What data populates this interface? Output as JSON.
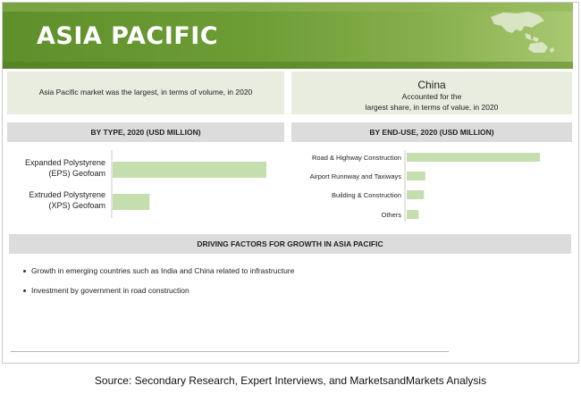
{
  "banner": {
    "title": "ASIA PACIFIC"
  },
  "summary": {
    "left_text": "Asia Pacific market was the largest, in terms of volume, in 2020",
    "right_country": "China",
    "right_line1": "Accounted for the",
    "right_line2": "largest share, in terms of value, in 2020"
  },
  "headers": {
    "by_type": "BY TYPE, 2020 (USD MILLION)",
    "by_end_use": "BY END-USE, 2020 (USD MILLION)",
    "driving": "DRIVING FACTORS FOR GROWTH IN ASIA PACIFIC"
  },
  "chart_data": [
    {
      "type": "bar",
      "orientation": "horizontal",
      "categories": [
        "Expanded Polystyrene (EPS) Geofoam",
        "Extruded Polystyrene (XPS) Geofoam"
      ],
      "category_lines": [
        [
          "Expanded Polystyrene",
          "(EPS) Geofoam"
        ],
        [
          "Extruded Polystyrene",
          "(XPS) Geofoam"
        ]
      ],
      "values": [
        100,
        24
      ],
      "xlim": [
        0,
        100
      ],
      "color": "#c5deae"
    },
    {
      "type": "bar",
      "orientation": "horizontal",
      "categories": [
        "Road & Highway Construction",
        "Airport Runnway and Taxiways",
        "Building & Construction",
        "Others"
      ],
      "values": [
        100,
        14,
        13,
        9
      ],
      "xlim": [
        0,
        100
      ],
      "color": "#c5deae"
    }
  ],
  "bullets": [
    "Growth in emerging countries such as India and China related to infrastructure",
    "Investment by government in road construction"
  ],
  "source": "Source: Secondary Research, Expert Interviews, and MarketsandMarkets Analysis",
  "colors": {
    "banner": "#6e9d36",
    "bar": "#c5deae",
    "panel": "#e8ede0",
    "header": "#dcdcdc"
  }
}
